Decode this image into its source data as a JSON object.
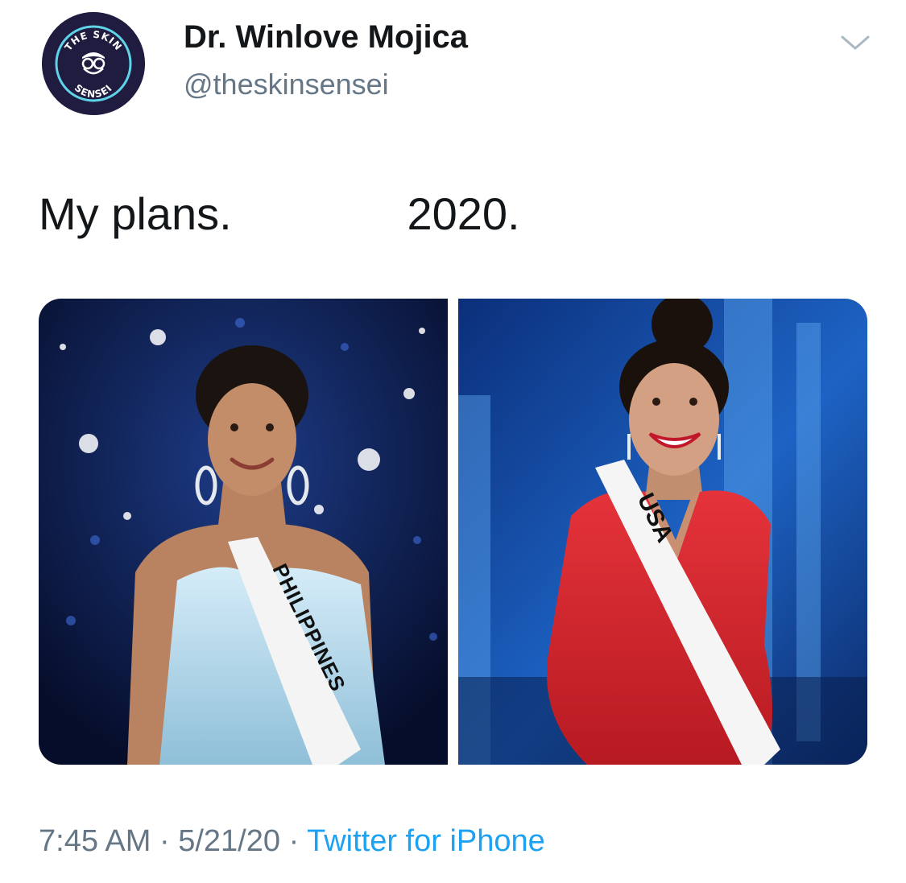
{
  "author": {
    "display_name": "Dr. Winlove Mojica",
    "handle": "@theskinsensei",
    "avatar_icon": "the-skin-sensei-logo",
    "avatar_text_top": "THE SKIN",
    "avatar_text_bottom": "SENSEI",
    "avatar_bg": "#201c40",
    "avatar_ring": "#5fd3e8"
  },
  "tweet": {
    "text": "My plans.              2020."
  },
  "media": {
    "left": {
      "sash_text": "PHILIPPINES",
      "dress_color": "#bfe1f2"
    },
    "right": {
      "sash_text": "USA",
      "dress_color": "#d9232b"
    }
  },
  "meta": {
    "time": "7:45 AM",
    "separator": "·",
    "date": "5/21/20",
    "source": "Twitter for iPhone",
    "link_color": "#1da1f2"
  },
  "icons": {
    "menu": "chevron-down-icon"
  }
}
